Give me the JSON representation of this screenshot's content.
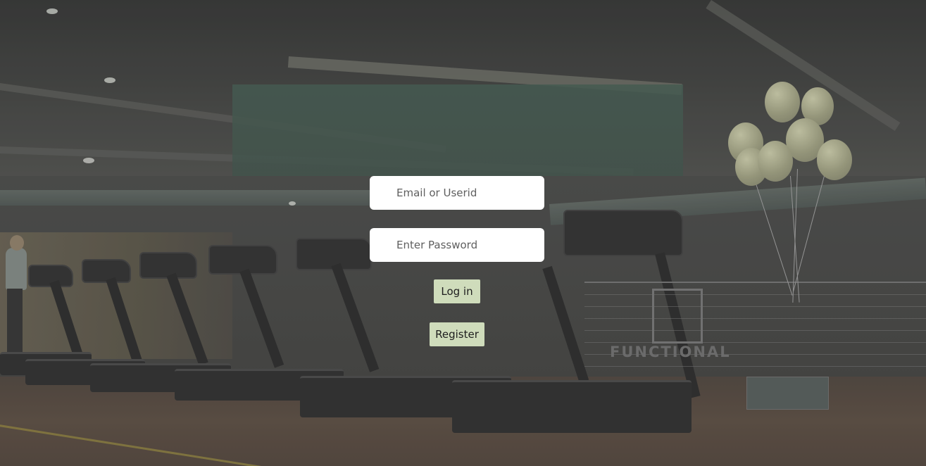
{
  "login": {
    "email_placeholder": "Email or Userid",
    "password_placeholder": "Enter Password",
    "login_label": "Log in",
    "register_label": "Register"
  },
  "background": {
    "sign_text": "FUNCTIONAL",
    "accent_color": "#cfdcbb"
  }
}
